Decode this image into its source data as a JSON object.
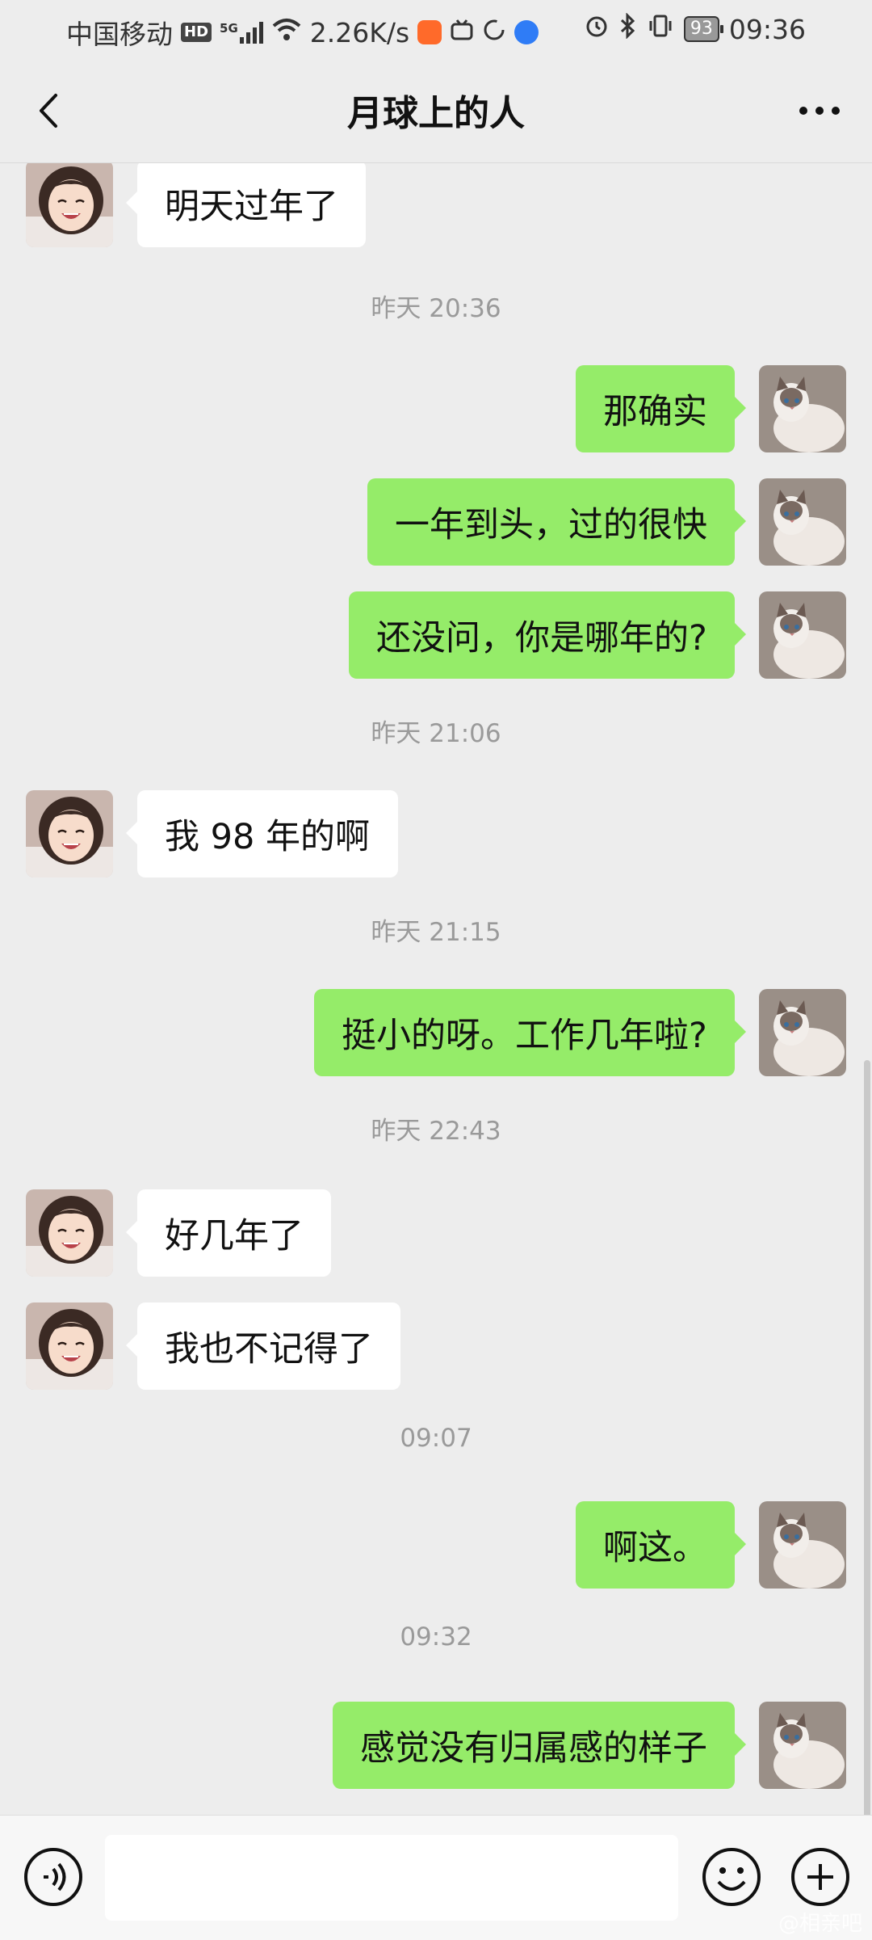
{
  "status_bar": {
    "carrier": "中国移动",
    "hd": "HD",
    "network": "5G",
    "speed": "2.26K/s",
    "battery": "93",
    "time": "09:36",
    "icons": [
      "signal-icon",
      "wifi-icon",
      "app-orange-icon",
      "bilibili-icon",
      "loop-icon",
      "app-blue-icon",
      "alarm-icon",
      "bluetooth-icon",
      "vibrate-icon",
      "battery-icon"
    ]
  },
  "header": {
    "title": "月球上的人",
    "back_icon": "back-chevron-icon",
    "more_icon": "more-dots-icon"
  },
  "messages": [
    {
      "type": "msg",
      "side": "in",
      "text": "明天过年了"
    },
    {
      "type": "time",
      "text": "昨天 20:36"
    },
    {
      "type": "msg",
      "side": "out",
      "text": "那确实"
    },
    {
      "type": "msg",
      "side": "out",
      "text": "一年到头，过的很快"
    },
    {
      "type": "msg",
      "side": "out",
      "text": "还没问，你是哪年的?"
    },
    {
      "type": "time",
      "text": "昨天 21:06"
    },
    {
      "type": "msg",
      "side": "in",
      "text": "我 98 年的啊"
    },
    {
      "type": "time",
      "text": "昨天 21:15"
    },
    {
      "type": "msg",
      "side": "out",
      "text": "挺小的呀。工作几年啦?"
    },
    {
      "type": "time",
      "text": "昨天 22:43"
    },
    {
      "type": "msg",
      "side": "in",
      "text": "好几年了"
    },
    {
      "type": "msg",
      "side": "in",
      "text": "我也不记得了"
    },
    {
      "type": "time",
      "text": "09:07"
    },
    {
      "type": "msg",
      "side": "out",
      "text": "啊这。"
    },
    {
      "type": "time",
      "text": "09:32"
    },
    {
      "type": "msg",
      "side": "out",
      "text": "感觉没有归属感的样子"
    }
  ],
  "input_bar": {
    "placeholder": "",
    "voice_icon": "voice-icon",
    "emoji_icon": "emoji-icon",
    "plus_icon": "plus-icon"
  },
  "watermark": "@相亲吧",
  "colors": {
    "background": "#EDEDED",
    "bubble_out": "#95EC69",
    "bubble_in": "#FFFFFF",
    "timestamp": "#9A9A9A"
  }
}
